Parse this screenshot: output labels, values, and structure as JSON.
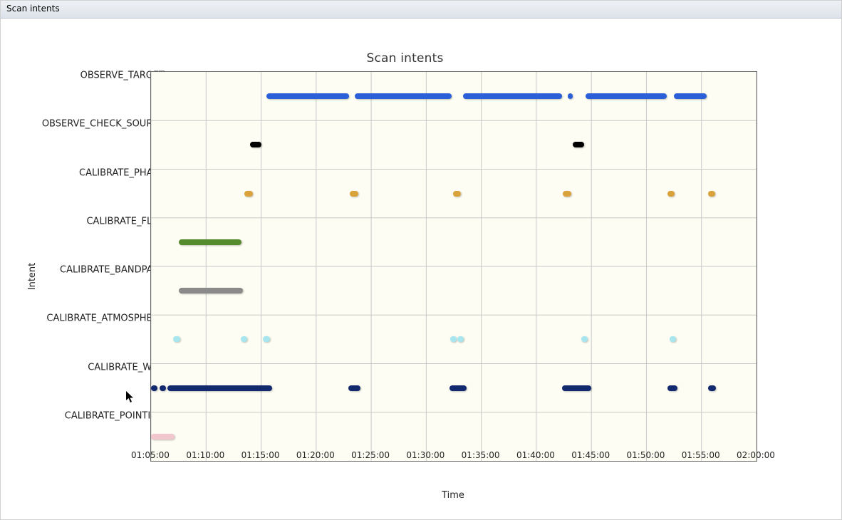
{
  "window": {
    "title": "Scan intents"
  },
  "chart_data": {
    "type": "gantt",
    "title": "Scan intents",
    "xlabel": "Time",
    "ylabel": "Intent",
    "x_ticks": [
      "01:05:00",
      "01:10:00",
      "01:15:00",
      "01:20:00",
      "01:25:00",
      "01:30:00",
      "01:35:00",
      "01:40:00",
      "01:45:00",
      "01:50:00",
      "01:55:00",
      "02:00:00"
    ],
    "x_range_seconds": [
      3900,
      7200
    ],
    "categories": [
      "OBSERVE_TARGET",
      "OBSERVE_CHECK_SOURCE",
      "CALIBRATE_PHASE",
      "CALIBRATE_FLUX",
      "CALIBRATE_BANDPASS",
      "CALIBRATE_ATMOSPHERE",
      "CALIBRATE_WVR",
      "CALIBRATE_POINTING"
    ],
    "colors": {
      "OBSERVE_TARGET": "#2a5fd8",
      "OBSERVE_CHECK_SOURCE": "#000000",
      "CALIBRATE_PHASE": "#d9a23a",
      "CALIBRATE_FLUX": "#568b2d",
      "CALIBRATE_BANDPASS": "#8a8a8a",
      "CALIBRATE_ATMOSPHERE": "#a7e6ee",
      "CALIBRATE_WVR": "#12286f",
      "CALIBRATE_POINTING": "#f1c7cd"
    },
    "series": [
      {
        "name": "OBSERVE_TARGET",
        "intervals": [
          {
            "start": "01:15:30",
            "end": "01:23:00"
          },
          {
            "start": "01:23:30",
            "end": "01:32:20"
          },
          {
            "start": "01:33:20",
            "end": "01:42:20"
          },
          {
            "start": "01:42:50",
            "end": "01:43:20"
          },
          {
            "start": "01:44:30",
            "end": "01:51:50"
          },
          {
            "start": "01:52:30",
            "end": "01:55:30"
          }
        ]
      },
      {
        "name": "OBSERVE_CHECK_SOURCE",
        "intervals": [
          {
            "start": "01:14:00",
            "end": "01:15:00"
          },
          {
            "start": "01:43:20",
            "end": "01:44:20"
          }
        ]
      },
      {
        "name": "CALIBRATE_PHASE",
        "intervals": [
          {
            "start": "01:13:30",
            "end": "01:14:15"
          },
          {
            "start": "01:23:05",
            "end": "01:23:50"
          },
          {
            "start": "01:32:25",
            "end": "01:33:10"
          },
          {
            "start": "01:42:25",
            "end": "01:43:10"
          },
          {
            "start": "01:51:55",
            "end": "01:52:35"
          },
          {
            "start": "01:55:35",
            "end": "01:56:15"
          }
        ]
      },
      {
        "name": "CALIBRATE_FLUX",
        "intervals": [
          {
            "start": "01:07:30",
            "end": "01:13:15"
          }
        ]
      },
      {
        "name": "CALIBRATE_BANDPASS",
        "intervals": [
          {
            "start": "01:07:30",
            "end": "01:13:20"
          }
        ]
      },
      {
        "name": "CALIBRATE_ATMOSPHERE",
        "intervals": [
          {
            "start": "01:07:00",
            "end": "01:07:40"
          },
          {
            "start": "01:13:10",
            "end": "01:13:45"
          },
          {
            "start": "01:15:10",
            "end": "01:15:50"
          },
          {
            "start": "01:32:10",
            "end": "01:32:45"
          },
          {
            "start": "01:32:50",
            "end": "01:33:25"
          },
          {
            "start": "01:44:05",
            "end": "01:44:40"
          },
          {
            "start": "01:52:05",
            "end": "01:52:40"
          }
        ]
      },
      {
        "name": "CALIBRATE_WVR",
        "intervals": [
          {
            "start": "01:05:00",
            "end": "01:05:35"
          },
          {
            "start": "01:05:45",
            "end": "01:06:20"
          },
          {
            "start": "01:06:30",
            "end": "01:16:00"
          },
          {
            "start": "01:22:55",
            "end": "01:24:00"
          },
          {
            "start": "01:32:05",
            "end": "01:33:40"
          },
          {
            "start": "01:42:20",
            "end": "01:45:00"
          },
          {
            "start": "01:51:55",
            "end": "01:52:50"
          },
          {
            "start": "01:55:35",
            "end": "01:56:20"
          }
        ]
      },
      {
        "name": "CALIBRATE_POINTING",
        "intervals": [
          {
            "start": "01:05:00",
            "end": "01:07:10"
          }
        ]
      }
    ]
  }
}
